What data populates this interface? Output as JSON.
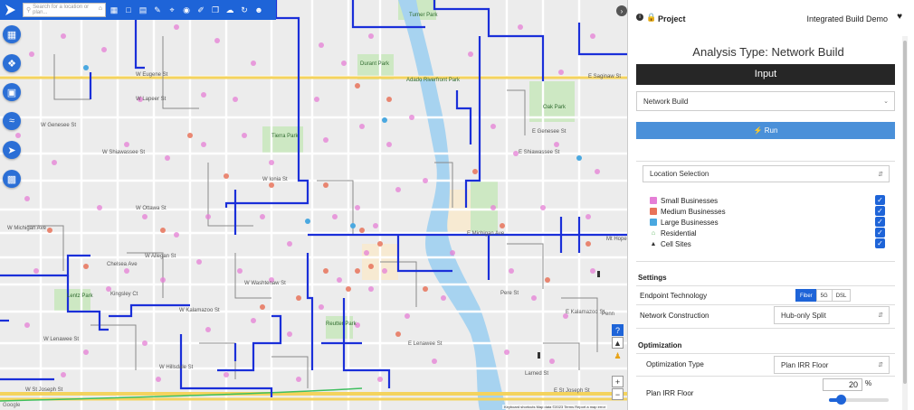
{
  "toolbar": {
    "search_placeholder": "Search for a location or plan..."
  },
  "map": {
    "streets": [
      "W Eugene St",
      "W Lapeer St",
      "W Genesee St",
      "W Shiawassee St",
      "W Ionia St",
      "W Ottawa St",
      "W Allegan St",
      "W Washtenaw St",
      "W Kalamazoo St",
      "W Hillsdale St",
      "W St Joseph St",
      "E Michigan Ave",
      "E Saginaw St",
      "E Shiawassee St",
      "E Kalamazoo St",
      "E St Joseph St",
      "W Michigan Ave",
      "Chelsea Ave",
      "Kingsley Ct",
      "W Lenawee St",
      "Larned St",
      "Pere St",
      "Penn",
      "Mt Hope",
      "E Genesee St",
      "E Lenawee St"
    ],
    "parks": [
      "Turner Park",
      "Durant Park",
      "Adado Riverfront Park",
      "Oak Park",
      "Reutter Park",
      "Lentz Park",
      "Tierra Park"
    ],
    "attribution": "Keyboard shortcuts   Map data ©2023   Terms   Report a map error",
    "google": "Google"
  },
  "panel": {
    "project_label": "Project",
    "project_name": "Integrated Build Demo",
    "analysis_title": "Analysis Type: Network Build",
    "input_label": "Input",
    "network_type": "Network Build",
    "run_label": "Run",
    "location_selection": "Location Selection",
    "location_items": [
      {
        "label": "Small Businesses",
        "color": "#e57fd6"
      },
      {
        "label": "Medium Businesses",
        "color": "#e8735a"
      },
      {
        "label": "Large Businesses",
        "color": "#4aa8e0"
      },
      {
        "label": "Residential",
        "color": "#4caf50"
      },
      {
        "label": "Cell Sites",
        "color": "#333333"
      }
    ],
    "settings_header": "Settings",
    "endpoint_label": "Endpoint Technology",
    "endpoint_options": [
      "Fiber",
      "5G",
      "DSL"
    ],
    "endpoint_selected": "Fiber",
    "construction_label": "Network Construction",
    "construction_value": "Hub-only Split",
    "optimization_header": "Optimization",
    "opt_type_label": "Optimization Type",
    "opt_type_value": "Plan IRR Floor",
    "irr_label": "Plan IRR Floor",
    "irr_value": "20",
    "irr_unit": "%",
    "irr_level_fraction": 0.2
  },
  "colors": {
    "accent": "#1e64d8",
    "fiber_route": "#1a2fd9",
    "input_bar": "#262626"
  }
}
